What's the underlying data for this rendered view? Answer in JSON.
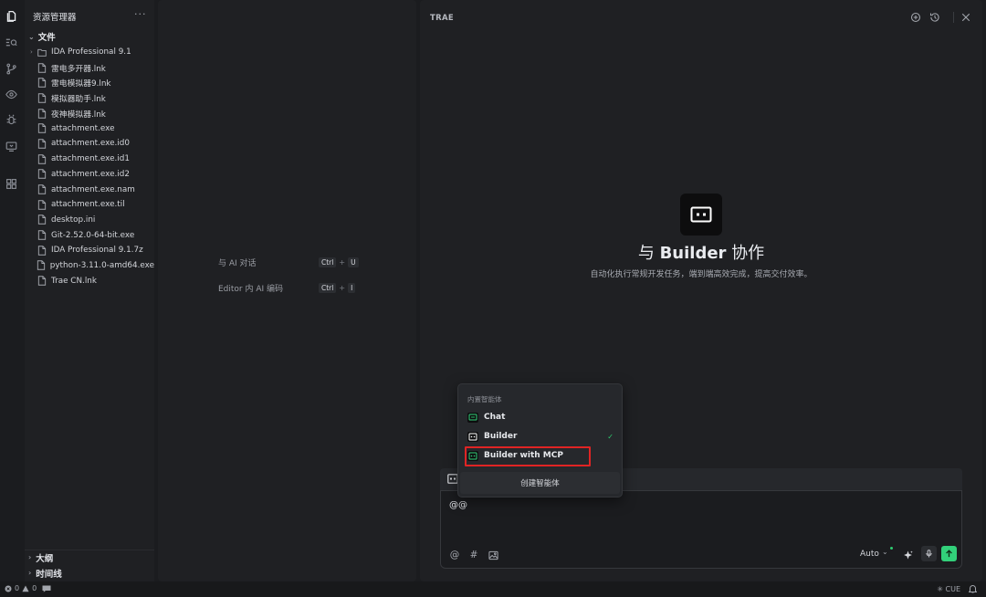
{
  "explorer": {
    "title": "资源管理器",
    "more": "···",
    "root": "文件",
    "items": [
      {
        "label": "IDA Professional 9.1",
        "type": "folder"
      },
      {
        "label": "雷电多开器.lnk",
        "type": "file"
      },
      {
        "label": "雷电模拟器9.lnk",
        "type": "file"
      },
      {
        "label": "模拟器助手.lnk",
        "type": "file"
      },
      {
        "label": "夜神模拟器.lnk",
        "type": "file"
      },
      {
        "label": "attachment.exe",
        "type": "file"
      },
      {
        "label": "attachment.exe.id0",
        "type": "file"
      },
      {
        "label": "attachment.exe.id1",
        "type": "file"
      },
      {
        "label": "attachment.exe.id2",
        "type": "file"
      },
      {
        "label": "attachment.exe.nam",
        "type": "file"
      },
      {
        "label": "attachment.exe.til",
        "type": "file"
      },
      {
        "label": "desktop.ini",
        "type": "file"
      },
      {
        "label": "Git-2.52.0-64-bit.exe",
        "type": "file"
      },
      {
        "label": "IDA Professional 9.1.7z",
        "type": "file"
      },
      {
        "label": "python-3.11.0-amd64.exe",
        "type": "file"
      },
      {
        "label": "Trae CN.lnk",
        "type": "file"
      }
    ],
    "outline": "大纲",
    "timeline": "时间线"
  },
  "editor": {
    "hints": [
      {
        "label": "与 AI 对话",
        "key1": "Ctrl",
        "key2": "U"
      },
      {
        "label": "Editor 内 AI 编码",
        "key1": "Ctrl",
        "key2": "I"
      }
    ],
    "plus": "+"
  },
  "ai_panel": {
    "title": "TRAE",
    "heading_prefix": "与",
    "heading_name": "Builder",
    "heading_suffix": "协作",
    "subheading": "自动化执行常规开发任务，端到端高效完成，提高交付效率。",
    "input_value": "@@",
    "model_label": "Auto",
    "tools": {
      "mention": "@",
      "hash": "#"
    }
  },
  "dropdown": {
    "header": "内置智能体",
    "items": [
      {
        "label": "Chat",
        "selected": false
      },
      {
        "label": "Builder",
        "selected": true
      },
      {
        "label": "Builder with MCP",
        "selected": false
      }
    ],
    "check": "✓",
    "create_label": "创建智能体"
  },
  "statusbar": {
    "errors": "0",
    "warnings": "0",
    "cue_label": "CUE"
  },
  "colors": {
    "accent_green": "#32d07a",
    "highlight_red": "#e02424",
    "background": "#1b1c1f",
    "panel": "#1f2023"
  }
}
